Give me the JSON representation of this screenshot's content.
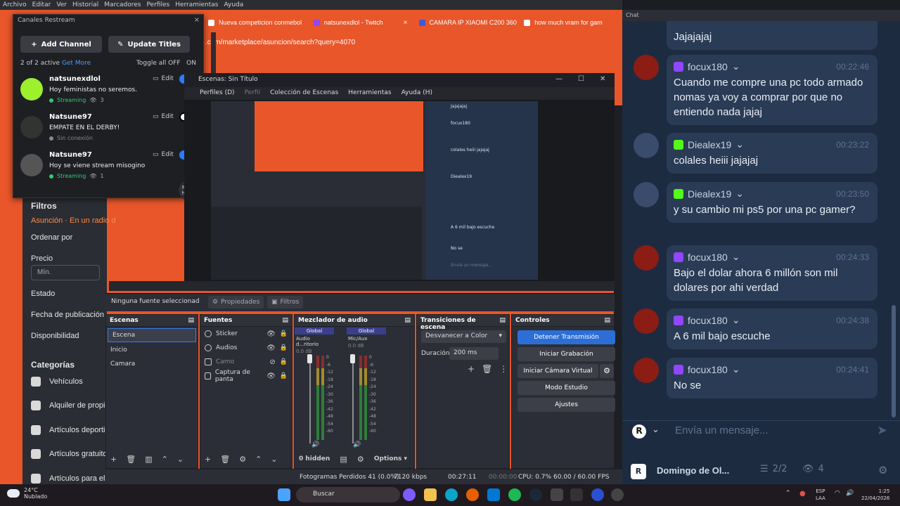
{
  "obs_menu": [
    "Archivo",
    "Editar",
    "Ver",
    "Historial",
    "Marcadores",
    "Perfiles",
    "Herramientas",
    "Ayuda"
  ],
  "browser": {
    "tabs": [
      "Nueva competicion conmebol",
      "natsunexdlol - Twitch",
      "CAMARA IP XIAOMI C200 360°",
      "how much vram for gam"
    ],
    "url": ".com/marketplace/asuncion/search?query=4070",
    "sidebar": {
      "filters": "Filtros",
      "location": "Asunción · En un radio d",
      "sort": "Ordenar por",
      "price": "Precio",
      "price_min_placeholder": "Mín.",
      "state": "Estado",
      "pub_date": "Fecha de publicación",
      "availability": "Disponibilidad",
      "categories": "Categorías",
      "cat_items": [
        "Vehículos",
        "Alquiler de propi",
        "Artículos deporti",
        "Artículos gratuito",
        "Artículos para el"
      ]
    }
  },
  "restream": {
    "title": "Canales Restream",
    "add_channel": "Add Channel",
    "update_titles": "Update Titles",
    "active": "2 of 2 active",
    "get_more": "Get More",
    "toggle_all": "Toggle all OFF",
    "on": "ON",
    "edit": "Edit",
    "channels": [
      {
        "name": "natsunexdlol",
        "desc": "Hoy feministas no seremos.",
        "status": "Streaming",
        "viewers": "3"
      },
      {
        "name": "Natsune97",
        "desc": "EMPATE EN EL DERBY!",
        "status": "Sin conexión",
        "viewers": ""
      },
      {
        "name": "Natsune97",
        "desc": "Hoy se viene stream misogino",
        "status": "Streaming",
        "viewers": "1"
      }
    ],
    "help": "Need help?"
  },
  "projector": {
    "title": "Escenas: Sin Título",
    "menu": [
      "Perfiles (D)",
      "Perfil",
      "Colección de Escenas",
      "Herramientas",
      "Ayuda (H)"
    ]
  },
  "obs": {
    "no_source": "Ninguna fuente seleccionad",
    "properties": "Propiedades",
    "filters": "Filtros",
    "scenes": {
      "title": "Escenas",
      "items": [
        "Escena",
        "Inicio",
        "Camara"
      ]
    },
    "sources": {
      "title": "Fuentes",
      "items": [
        "Sticker",
        "Audios",
        "Camo",
        "Captura de panta"
      ]
    },
    "mixer": {
      "title": "Mezclador de audio",
      "global": "Global",
      "ch1": "Audio d...ritorio",
      "ch2": "Mic/Aux",
      "db": "0.0 dB",
      "scale": [
        "0",
        "-6",
        "-12",
        "-18",
        "-24",
        "-30",
        "-36",
        "-42",
        "-48",
        "-54",
        "-60"
      ],
      "hidden": "0 hidden",
      "options": "Options"
    },
    "transitions": {
      "title": "Transiciones de escena",
      "select": "Desvanecer a Color",
      "duration_label": "Duración",
      "duration": "200 ms"
    },
    "controls": {
      "title": "Controles",
      "buttons": [
        "Detener Transmisión",
        "Iniciar Grabación",
        "Iniciar Cámara Virtual",
        "Modo Estudio",
        "Ajustes"
      ]
    },
    "status": {
      "dropped": "Fotogramas Perdidos 41 (0.0%)",
      "bitrate": "7120 kbps",
      "time1": "00:27:11",
      "time2": "00:00:00",
      "cpu": "CPU: 0.7%",
      "fps": "60.00 / 60.00 FPS"
    }
  },
  "chat": {
    "title": "Chat",
    "messages": [
      {
        "user": "",
        "time": "",
        "text": "Jajajajaj",
        "platform": "twitch"
      },
      {
        "user": "focux180",
        "time": "00:22:46",
        "text": "Cuando me compre una pc todo armado nomas ya voy a comprar por que no entiendo nada jajaj",
        "platform": "twitch"
      },
      {
        "user": "Diealex19",
        "time": "00:23:22",
        "text": "colales heiii jajajaj",
        "platform": "kick"
      },
      {
        "user": "Diealex19",
        "time": "00:23:50",
        "text": "y su cambio mi ps5 por una pc gamer?",
        "platform": "kick"
      },
      {
        "user": "focux180",
        "time": "00:24:33",
        "text": "Bajo el dolar ahora 6 millón son mil dolares por ahi verdad",
        "platform": "twitch"
      },
      {
        "user": "focux180",
        "time": "00:24:38",
        "text": "A 6 mil bajo escuche",
        "platform": "twitch"
      },
      {
        "user": "focux180",
        "time": "00:24:41",
        "text": "No se",
        "platform": "twitch"
      }
    ],
    "input_placeholder": "Envía un mensaje...",
    "footer_name": "Domingo de Ol...",
    "footer_count": "2/2",
    "footer_viewers": "4"
  },
  "taskbar": {
    "temp": "24°C",
    "weather": "Nublado",
    "search": "Buscar",
    "lang": "ESP",
    "lang2": "LAA",
    "time": "1:25",
    "date": "22/04/2026"
  },
  "colors": {
    "accent_orange": "#e8562a",
    "twitch": "#9146ff",
    "kick": "#53fc18",
    "obs_blue": "#2c6ed6"
  }
}
